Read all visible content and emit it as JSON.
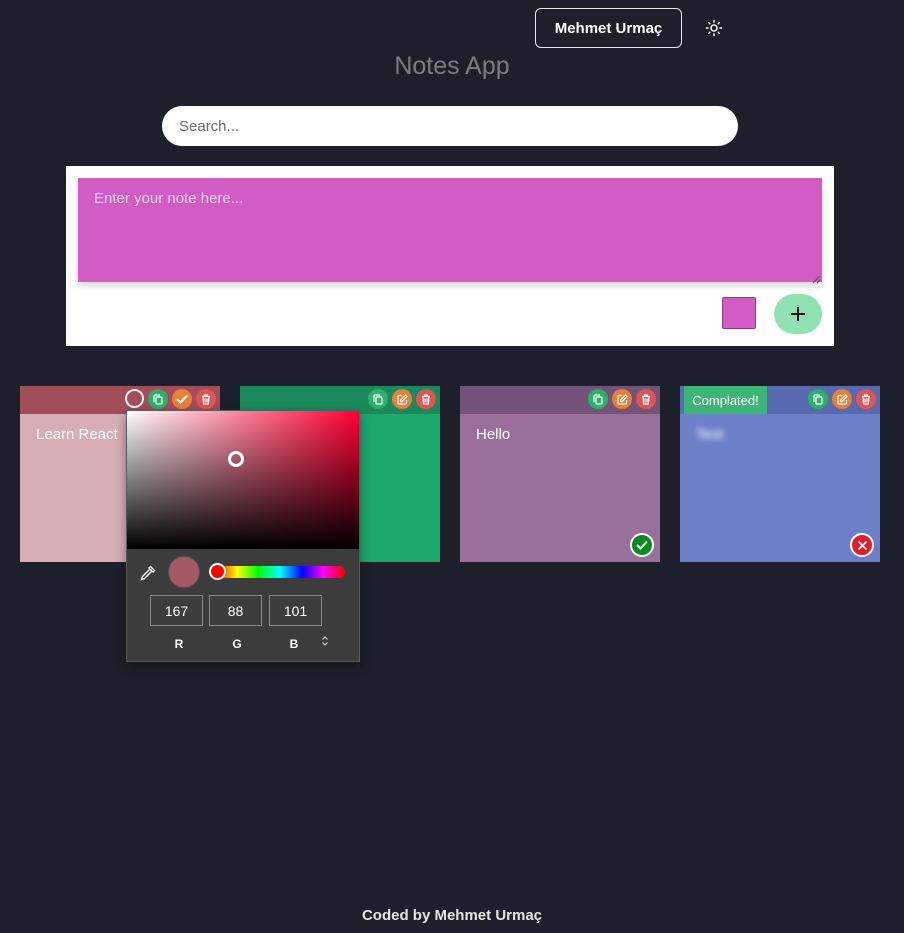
{
  "header": {
    "user_button": "Mehmet Urmaç",
    "theme_icon": "sun-icon"
  },
  "app_title": "Notes App",
  "search": {
    "placeholder": "Search..."
  },
  "composer": {
    "placeholder": "Enter your note here...",
    "selected_color": "#d25cc4",
    "add_icon": "plus-icon"
  },
  "notes": [
    {
      "text": "Learn React",
      "bar_color": "#a14d5a",
      "body_color": "#d7aeb4",
      "status": "none",
      "editing_color": true
    },
    {
      "text": "",
      "bar_color": "#1a8a5a",
      "body_color": "#1fa86d",
      "status": "none"
    },
    {
      "text": "Hello",
      "bar_color": "#745379",
      "body_color": "#9a709a",
      "status": "completed"
    },
    {
      "text": "Test",
      "bar_color": "#5a6ab0",
      "body_color": "#6e7fc9",
      "status": "incomplete",
      "badge": "Complated!"
    }
  ],
  "color_picker": {
    "r": "167",
    "g": "88",
    "b": "101",
    "r_label": "R",
    "g_label": "G",
    "b_label": "B",
    "preview_color": "#a75865"
  },
  "footer": "Coded by Mehmet Urmaç"
}
